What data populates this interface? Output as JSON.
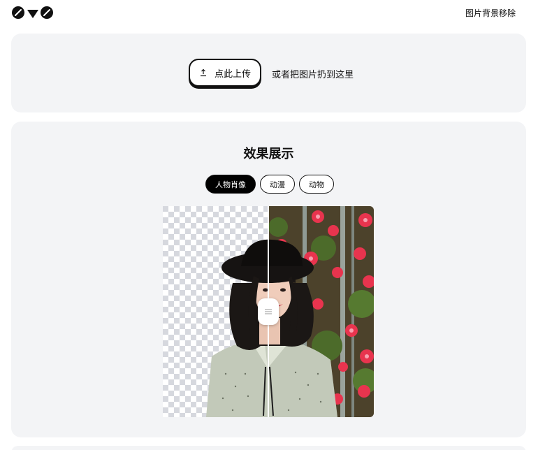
{
  "header": {
    "logo_icon": "pencil-triangle-pencil-logo",
    "nav_link": "图片背景移除"
  },
  "upload": {
    "button_label": "点此上传",
    "button_icon": "upload-arrow-icon",
    "drop_hint": "或者把图片扔到这里"
  },
  "demo": {
    "title": "效果展示",
    "tabs": [
      {
        "label": "人物肖像",
        "active": true
      },
      {
        "label": "动漫",
        "active": false
      },
      {
        "label": "动物",
        "active": false
      }
    ],
    "compare_handle_icon": "drag-handle-icon"
  },
  "colors": {
    "card_bg": "#f3f4f6",
    "accent": "#000000",
    "flower_red": "#e8344e"
  }
}
